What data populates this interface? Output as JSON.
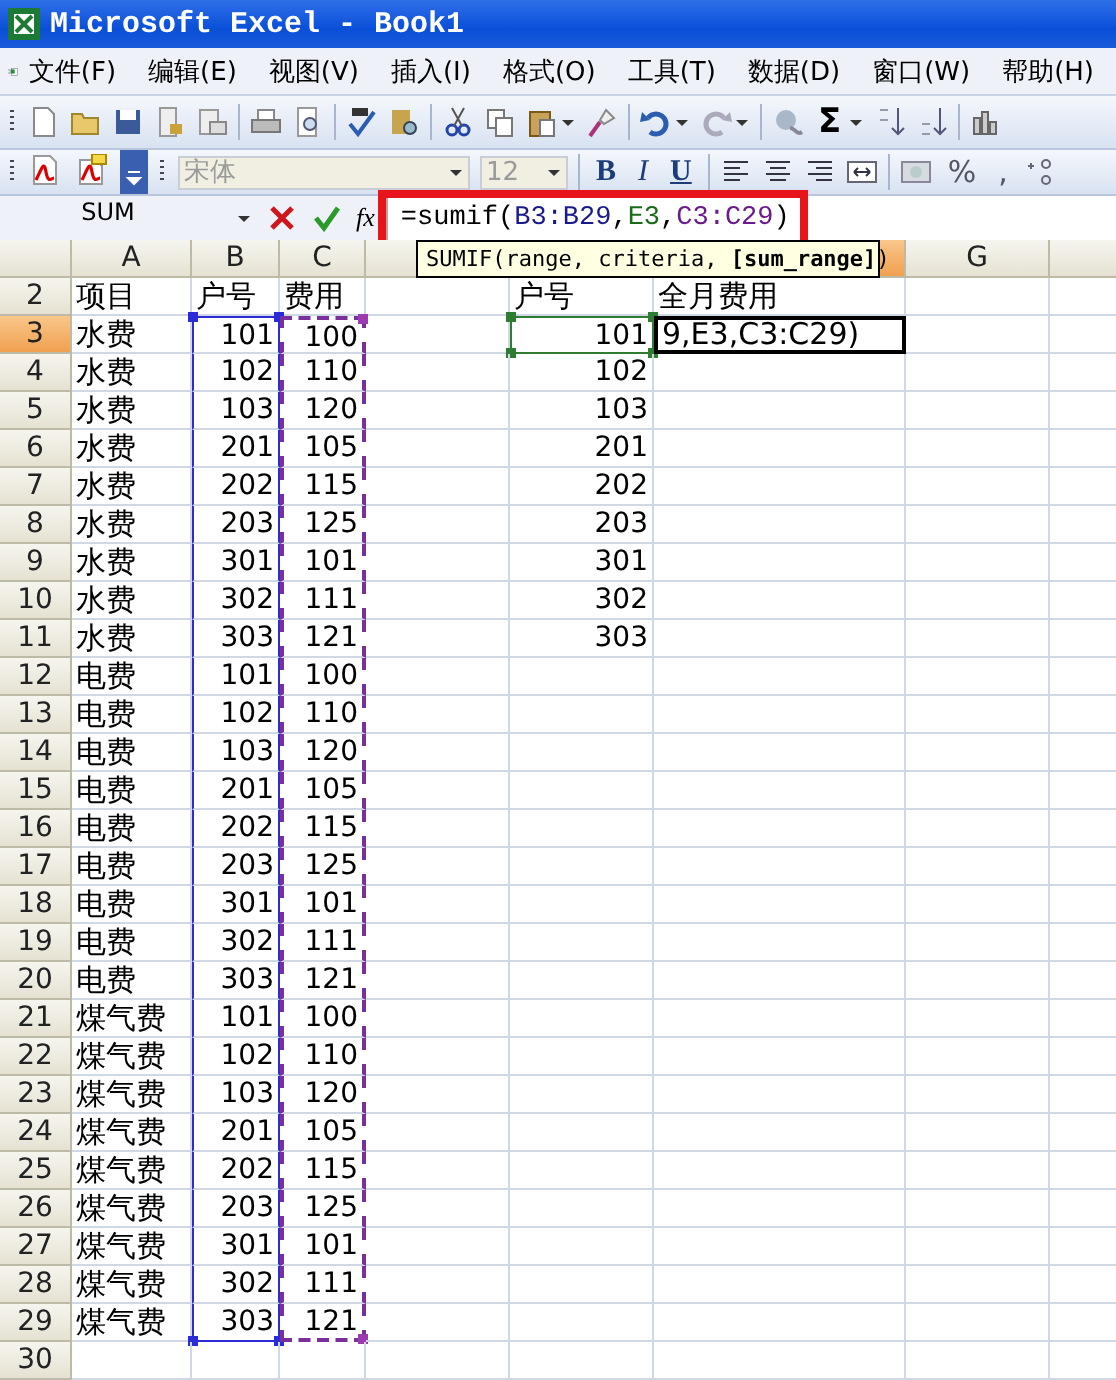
{
  "window": {
    "title": "Microsoft Excel - Book1"
  },
  "menu": [
    "文件(F)",
    "编辑(E)",
    "视图(V)",
    "插入(I)",
    "格式(O)",
    "工具(T)",
    "数据(D)",
    "窗口(W)",
    "帮助(H)"
  ],
  "standard_toolbar": {
    "sum": "Σ"
  },
  "format_toolbar": {
    "font": "宋体",
    "size": "12",
    "style_buttons": [
      "B",
      "I",
      "U"
    ],
    "percent": "%",
    "comma": ","
  },
  "formula_bar": {
    "name_box": "SUM",
    "fx": "fx",
    "formula": [
      {
        "text": "=sumif(",
        "color": "#000000"
      },
      {
        "text": "B3:B29",
        "color": "#1a1a8c"
      },
      {
        "text": ",",
        "color": "#000000"
      },
      {
        "text": "E3",
        "color": "#1a6b1a"
      },
      {
        "text": ",",
        "color": "#000000"
      },
      {
        "text": "C3:C29",
        "color": "#6b1a8c"
      },
      {
        "text": ")",
        "color": "#000000"
      }
    ]
  },
  "tooltip": "SUMIF(range, criteria, **[sum_range]**)",
  "columns": [
    {
      "label": "A",
      "selected": false
    },
    {
      "label": "B",
      "selected": false
    },
    {
      "label": "C",
      "selected": false,
      "marquee": true
    },
    {
      "selected": false
    },
    {},
    {
      "selected": true
    },
    {
      "label": "G",
      "selected": false
    },
    {
      "selected": false
    }
  ],
  "rows": [
    {
      "number": "2",
      "selected": false,
      "a": "项目",
      "b": "户号",
      "c": "费用",
      "e": "户号",
      "f": "全月费用"
    },
    {
      "number": "3",
      "selected": true,
      "a": "水费",
      "b": "101",
      "c": "100",
      "e": "101",
      "f": "9,E3,C3:C29)",
      "editing": true,
      "highlights": {
        "b": {
          "color": "#2b2bd9"
        },
        "c": {
          "color": "#7b2f9c"
        },
        "e": {
          "color": "#2e7d32"
        }
      }
    },
    {
      "number": "4",
      "selected": false,
      "a": "水费",
      "b": "102",
      "c": "110",
      "e": "102",
      "highlights": {
        "b": {
          "color": "#2b2bd9"
        },
        "c": {
          "color": "#7b2f9c"
        }
      }
    },
    {
      "number": "5",
      "selected": false,
      "a": "水费",
      "b": "103",
      "c": "120",
      "e": "103",
      "highlights": {
        "b": {
          "color": "#2b2bd9"
        },
        "c": {
          "color": "#7b2f9c"
        }
      }
    },
    {
      "number": "6",
      "selected": false,
      "a": "水费",
      "b": "201",
      "c": "105",
      "e": "201",
      "highlights": {
        "b": {
          "color": "#2b2bd9"
        },
        "c": {
          "color": "#7b2f9c"
        }
      }
    },
    {
      "number": "7",
      "selected": false,
      "a": "水费",
      "b": "202",
      "c": "115",
      "e": "202",
      "highlights": {
        "b": {
          "color": "#2b2bd9"
        },
        "c": {
          "color": "#7b2f9c"
        }
      }
    },
    {
      "number": "8",
      "selected": false,
      "a": "水费",
      "b": "203",
      "c": "125",
      "e": "203",
      "highlights": {
        "b": {
          "color": "#2b2bd9"
        },
        "c": {
          "color": "#7b2f9c"
        }
      }
    },
    {
      "number": "9",
      "selected": false,
      "a": "水费",
      "b": "301",
      "c": "101",
      "e": "301",
      "highlights": {
        "b": {
          "color": "#2b2bd9"
        },
        "c": {
          "color": "#7b2f9c"
        }
      }
    },
    {
      "number": "10",
      "selected": false,
      "a": "水费",
      "b": "302",
      "c": "111",
      "e": "302",
      "highlights": {
        "b": {
          "color": "#2b2bd9"
        },
        "c": {
          "color": "#7b2f9c"
        }
      }
    },
    {
      "number": "11",
      "selected": false,
      "a": "水费",
      "b": "303",
      "c": "121",
      "e": "303",
      "highlights": {
        "b": {
          "color": "#2b2bd9"
        },
        "c": {
          "color": "#7b2f9c"
        }
      }
    },
    {
      "number": "12",
      "selected": false,
      "a": "电费",
      "b": "101",
      "c": "100",
      "highlights": {
        "b": {
          "color": "#2b2bd9"
        },
        "c": {
          "color": "#7b2f9c"
        }
      }
    },
    {
      "number": "13",
      "selected": false,
      "a": "电费",
      "b": "102",
      "c": "110",
      "highlights": {
        "b": {
          "color": "#2b2bd9"
        },
        "c": {
          "color": "#7b2f9c"
        }
      }
    },
    {
      "number": "14",
      "selected": false,
      "a": "电费",
      "b": "103",
      "c": "120",
      "highlights": {
        "b": {
          "color": "#2b2bd9"
        },
        "c": {
          "color": "#7b2f9c"
        }
      }
    },
    {
      "number": "15",
      "selected": false,
      "a": "电费",
      "b": "201",
      "c": "105",
      "highlights": {
        "b": {
          "color": "#2b2bd9"
        },
        "c": {
          "color": "#7b2f9c"
        }
      }
    },
    {
      "number": "16",
      "selected": false,
      "a": "电费",
      "b": "202",
      "c": "115",
      "highlights": {
        "b": {
          "color": "#2b2bd9"
        },
        "c": {
          "color": "#7b2f9c"
        }
      }
    },
    {
      "number": "17",
      "selected": false,
      "a": "电费",
      "b": "203",
      "c": "125",
      "highlights": {
        "b": {
          "color": "#2b2bd9"
        },
        "c": {
          "color": "#7b2f9c"
        }
      }
    },
    {
      "number": "18",
      "selected": false,
      "a": "电费",
      "b": "301",
      "c": "101",
      "highlights": {
        "b": {
          "color": "#2b2bd9"
        },
        "c": {
          "color": "#7b2f9c"
        }
      }
    },
    {
      "number": "19",
      "selected": false,
      "a": "电费",
      "b": "302",
      "c": "111",
      "highlights": {
        "b": {
          "color": "#2b2bd9"
        },
        "c": {
          "color": "#7b2f9c"
        }
      }
    },
    {
      "number": "20",
      "selected": false,
      "a": "电费",
      "b": "303",
      "c": "121",
      "highlights": {
        "b": {
          "color": "#2b2bd9"
        },
        "c": {
          "color": "#7b2f9c"
        }
      }
    },
    {
      "number": "21",
      "selected": false,
      "a": "煤气费",
      "b": "101",
      "c": "100",
      "highlights": {
        "b": {
          "color": "#2b2bd9"
        },
        "c": {
          "color": "#7b2f9c"
        }
      }
    },
    {
      "number": "22",
      "selected": false,
      "a": "煤气费",
      "b": "102",
      "c": "110",
      "highlights": {
        "b": {
          "color": "#2b2bd9"
        },
        "c": {
          "color": "#7b2f9c"
        }
      }
    },
    {
      "number": "23",
      "selected": false,
      "a": "煤气费",
      "b": "103",
      "c": "120",
      "highlights": {
        "b": {
          "color": "#2b2bd9"
        },
        "c": {
          "color": "#7b2f9c"
        }
      }
    },
    {
      "number": "24",
      "selected": false,
      "a": "煤气费",
      "b": "201",
      "c": "105",
      "highlights": {
        "b": {
          "color": "#2b2bd9"
        },
        "c": {
          "color": "#7b2f9c"
        }
      }
    },
    {
      "number": "25",
      "selected": false,
      "a": "煤气费",
      "b": "202",
      "c": "115",
      "highlights": {
        "b": {
          "color": "#2b2bd9"
        },
        "c": {
          "color": "#7b2f9c"
        }
      }
    },
    {
      "number": "26",
      "selected": false,
      "a": "煤气费",
      "b": "203",
      "c": "125",
      "highlights": {
        "b": {
          "color": "#2b2bd9"
        },
        "c": {
          "color": "#7b2f9c"
        }
      }
    },
    {
      "number": "27",
      "selected": false,
      "a": "煤气费",
      "b": "301",
      "c": "101",
      "highlights": {
        "b": {
          "color": "#2b2bd9"
        },
        "c": {
          "color": "#7b2f9c"
        }
      }
    },
    {
      "number": "28",
      "selected": false,
      "a": "煤气费",
      "b": "302",
      "c": "111",
      "highlights": {
        "b": {
          "color": "#2b2bd9"
        },
        "c": {
          "color": "#7b2f9c"
        }
      }
    },
    {
      "number": "29",
      "selected": false,
      "a": "煤气费",
      "b": "303",
      "c": "121",
      "highlights": {
        "b": {
          "color": "#2b2bd9"
        },
        "c": {
          "color": "#7b2f9c"
        }
      }
    },
    {
      "number": "30",
      "selected": false
    }
  ]
}
